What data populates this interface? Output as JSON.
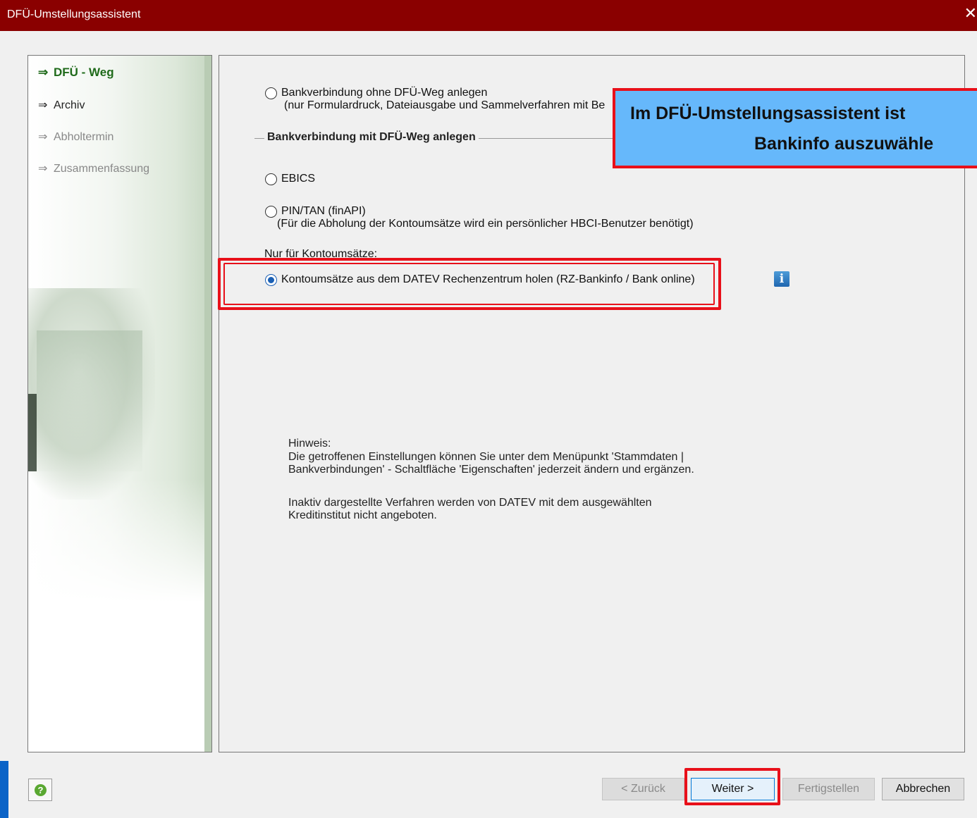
{
  "window": {
    "title": "DFÜ-Umstellungsassistent",
    "close_glyph": "✕"
  },
  "nav": {
    "arrow_glyph": "⇒",
    "items": [
      {
        "label": "DFÜ - Weg",
        "state": "active"
      },
      {
        "label": "Archiv",
        "state": "normal"
      },
      {
        "label": "Abholtermin",
        "state": "disabled"
      },
      {
        "label": "Zusammenfassung",
        "state": "disabled"
      }
    ]
  },
  "options": {
    "without_dfu": {
      "label": "Bankverbindung ohne DFÜ-Weg anlegen",
      "sub": "(nur Formulardruck, Dateiausgabe und Sammelverfahren mit Be",
      "checked": false
    },
    "group_label": "Bankverbindung mit DFÜ-Weg anlegen",
    "ebics": {
      "label": "EBICS",
      "checked": false
    },
    "pintan": {
      "label": "PIN/TAN  (finAPI)",
      "sub": "(Für die Abholung der Kontoumsätze wird ein persönlicher HBCI-Benutzer benötigt)",
      "checked": false
    },
    "section_label": "Nur für Kontoumsätze:",
    "rz": {
      "label": "Kontoumsätze aus dem DATEV Rechenzentrum holen (RZ-Bankinfo / Bank online)",
      "checked": true
    },
    "info_icon": "i"
  },
  "hint": {
    "title": "Hinweis:",
    "line1": "Die getroffenen Einstellungen können Sie unter dem Menüpunkt 'Stammdaten |",
    "line2": "Bankverbindungen' - Schaltfläche 'Eigenschaften' jederzeit ändern und ergänzen.",
    "line3": "Inaktiv dargestellte Verfahren werden von DATEV mit dem ausgewählten",
    "line4": "Kreditinstitut nicht angeboten."
  },
  "callout": {
    "line1": "Im DFÜ-Umstellungsassistent ist",
    "line2": "Bankinfo auszuwähle"
  },
  "footer": {
    "help_glyph": "?",
    "back": "< Zurück",
    "next": "Weiter >",
    "finish": "Fertigstellen",
    "cancel": "Abbrechen"
  },
  "colors": {
    "titlebar": "#8a0000",
    "highlight": "#e8101a",
    "callout_bg": "#66b8fb",
    "nav_active": "#1f6a1a"
  }
}
